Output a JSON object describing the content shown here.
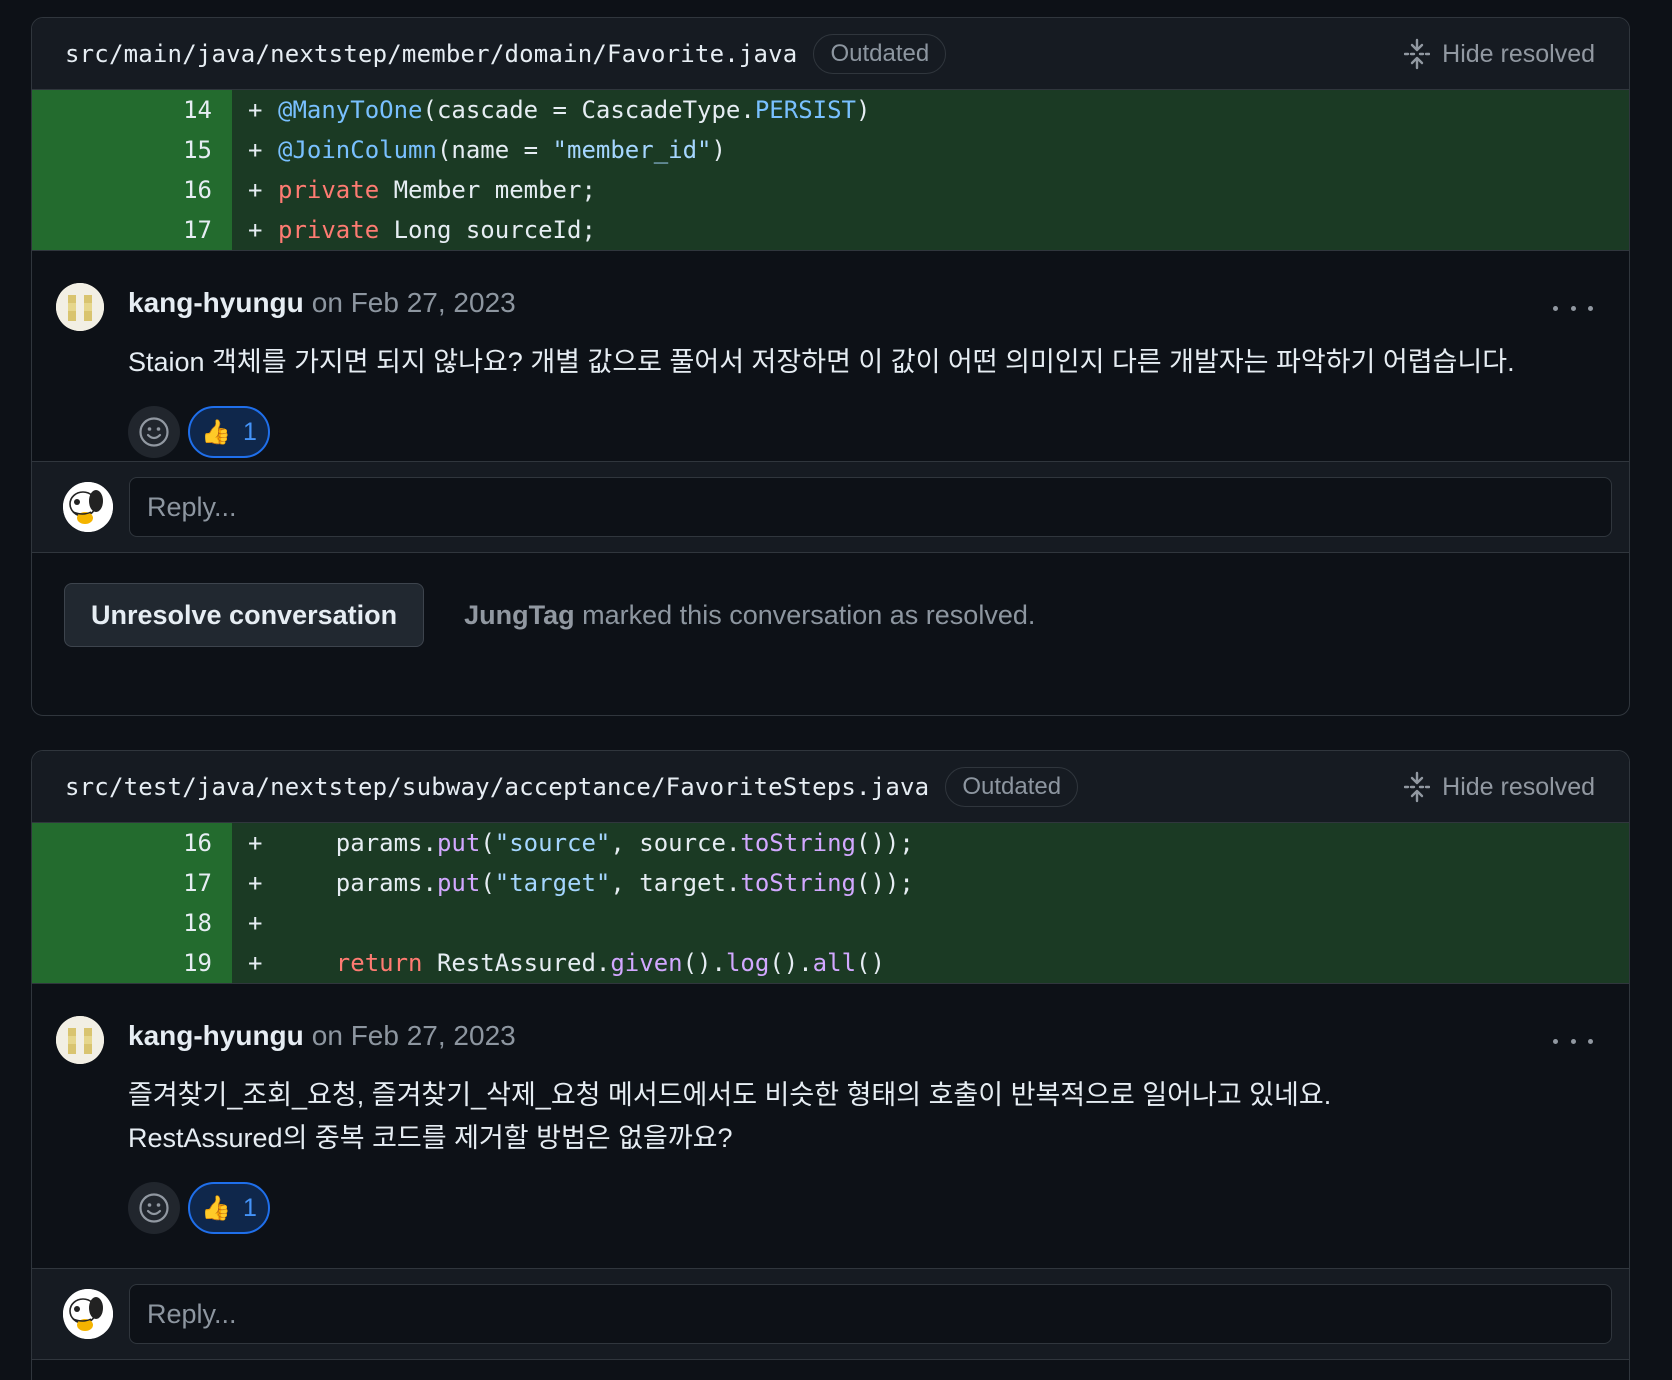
{
  "hide_resolved_label": "Hide resolved",
  "reply_placeholder": "Reply...",
  "threads": [
    {
      "file_path": "src/main/java/nextstep/member/domain/Favorite.java",
      "badge": "Outdated",
      "lines": [
        {
          "num": "14",
          "sign": "+"
        },
        {
          "num": "15",
          "sign": "+"
        },
        {
          "num": "16",
          "sign": "+"
        },
        {
          "num": "17",
          "sign": "+"
        }
      ],
      "comment": {
        "author": "kang-hyungu",
        "date": "on Feb 27, 2023",
        "body_lines": [
          "Staion 객체를 가지면 되지 않나요? 개별 값으로 풀어서 저장하면 이 값이 어떤 의미인지 다른 개발자는 파악하기 어렵습니다."
        ],
        "reaction_emoji": "👍",
        "reaction_count": "1"
      },
      "resolve": {
        "button_label": "Unresolve conversation",
        "resolver": "JungTag",
        "message": "marked this conversation as resolved."
      }
    },
    {
      "file_path": "src/test/java/nextstep/subway/acceptance/FavoriteSteps.java",
      "badge": "Outdated",
      "lines": [
        {
          "num": "16",
          "sign": "+"
        },
        {
          "num": "17",
          "sign": "+"
        },
        {
          "num": "18",
          "sign": "+"
        },
        {
          "num": "19",
          "sign": "+"
        }
      ],
      "comment": {
        "author": "kang-hyungu",
        "date": "on Feb 27, 2023",
        "body_lines": [
          "즐겨찾기_조회_요청, 즐겨찾기_삭제_요청 메서드에서도 비슷한 형태의 호출이 반복적으로 일어나고 있네요.",
          "RestAssured의 중복 코드를 제거할 방법은 없을까요?"
        ],
        "reaction_emoji": "👍",
        "reaction_count": "1"
      }
    }
  ],
  "code_tokens": {
    "t0l0": [
      [
        "@ManyToOne",
        "ann"
      ],
      [
        "(cascade = CascadeType.",
        ""
      ],
      [
        "PERSIST",
        "const"
      ],
      [
        ")",
        ""
      ]
    ],
    "t0l1": [
      [
        "@JoinColumn",
        "ann"
      ],
      [
        "(name = ",
        ""
      ],
      [
        "\"member_id\"",
        "str"
      ],
      [
        ")",
        ""
      ]
    ],
    "t0l2": [
      [
        "private",
        "kw"
      ],
      [
        " Member member;",
        ""
      ]
    ],
    "t0l3": [
      [
        "private",
        "kw"
      ],
      [
        " Long sourceId;",
        ""
      ]
    ],
    "t1l0": [
      [
        "    params.",
        ""
      ],
      [
        "put",
        "fn"
      ],
      [
        "(",
        ""
      ],
      [
        "\"source\"",
        "str"
      ],
      [
        ", source.",
        ""
      ],
      [
        "toString",
        "fn"
      ],
      [
        "());",
        ""
      ]
    ],
    "t1l1": [
      [
        "    params.",
        ""
      ],
      [
        "put",
        "fn"
      ],
      [
        "(",
        ""
      ],
      [
        "\"target\"",
        "str"
      ],
      [
        ", target.",
        ""
      ],
      [
        "toString",
        "fn"
      ],
      [
        "());",
        ""
      ]
    ],
    "t1l2": [],
    "t1l3": [
      [
        "    ",
        ""
      ],
      [
        "return",
        "kw"
      ],
      [
        " RestAssured.",
        ""
      ],
      [
        "given",
        "fn"
      ],
      [
        "().",
        ""
      ],
      [
        "log",
        "fn"
      ],
      [
        "().",
        ""
      ],
      [
        "all",
        "fn"
      ],
      [
        "()",
        ""
      ]
    ]
  },
  "colors": {
    "background": "#0d1117",
    "added_line": "#1b3a24",
    "added_gutter": "#236b2e",
    "accent_blue": "#4493f8"
  }
}
